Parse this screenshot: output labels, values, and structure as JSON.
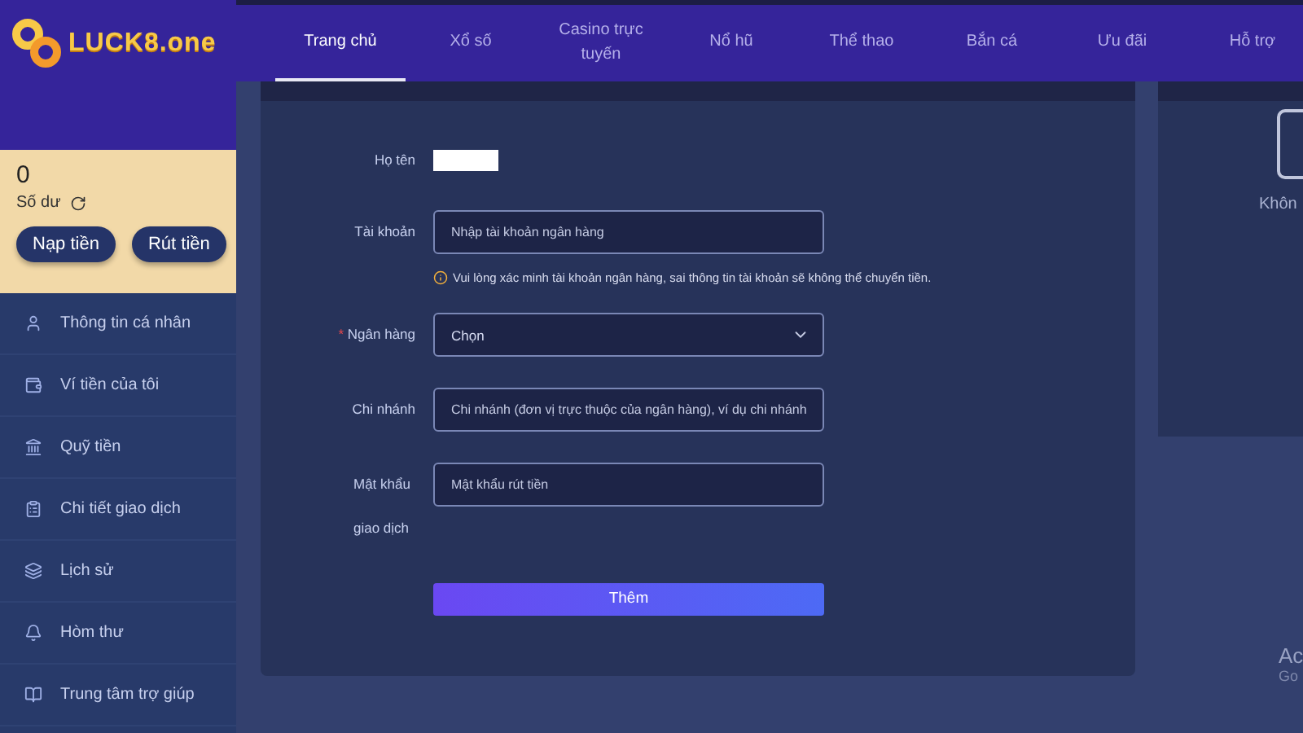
{
  "logo": {
    "text": "LUCK8.one"
  },
  "nav": [
    {
      "label": "Trang chủ",
      "selected": true
    },
    {
      "label": "Xổ số",
      "selected": false
    },
    {
      "label": "Casino trực tuyến",
      "selected": false
    },
    {
      "label": "Nổ hũ",
      "selected": false
    },
    {
      "label": "Thể thao",
      "selected": false
    },
    {
      "label": "Bắn cá",
      "selected": false
    },
    {
      "label": "Ưu đãi",
      "selected": false
    },
    {
      "label": "Hỗ trợ",
      "selected": false
    }
  ],
  "balance": {
    "amount": "0",
    "label": "Số dư",
    "buttons": [
      "Nạp tiền",
      "Rút tiền"
    ]
  },
  "menu": [
    {
      "label": "Thông tin cá nhân",
      "kind": "user"
    },
    {
      "label": "Ví tiền của tôi",
      "kind": "wallet"
    },
    {
      "label": "Quỹ tiền",
      "kind": "fund"
    },
    {
      "label": "Chi tiết giao dịch",
      "kind": "clipboard"
    },
    {
      "label": "Lịch sử",
      "kind": "history"
    },
    {
      "label": "Hòm thư",
      "kind": "mail"
    },
    {
      "label": "Trung tâm trợ giúp",
      "kind": "book"
    }
  ],
  "form": {
    "fields": [
      {
        "kind": "static",
        "label": "Họ tên"
      },
      {
        "kind": "input",
        "label": "Tài khoản",
        "placeholder": "Nhập tài khoản ngân hàng",
        "note": "Vui lòng xác minh tài khoản ngân hàng, sai thông tin tài khoản sẽ không thể chuyển tiền."
      },
      {
        "kind": "select",
        "label": "Ngân hàng",
        "value": "Chọn",
        "required_mark": "*"
      },
      {
        "kind": "input",
        "label": "Chi nhánh",
        "placeholder": "Chi nhánh (đơn vị trực thuộc của ngân hàng), ví dụ chi nhánh"
      },
      {
        "kind": "input",
        "label": "Mật khẩu giao dịch",
        "placeholder": "Mật khẩu rút tiền"
      }
    ],
    "submit": "Thêm"
  },
  "side_panel": {
    "empty_text": "Khôn",
    "overlay_lines": [
      "Ac",
      "Go"
    ]
  }
}
